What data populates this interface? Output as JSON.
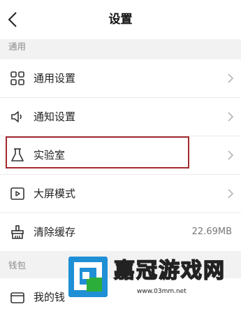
{
  "header": {
    "title": "设置"
  },
  "sections": [
    {
      "label": "通用"
    },
    {
      "label": "钱包"
    }
  ],
  "rows": [
    {
      "label": "通用设置",
      "icon": "grid-icon"
    },
    {
      "label": "通知设置",
      "icon": "speaker-icon"
    },
    {
      "label": "实验室",
      "icon": "flask-icon"
    },
    {
      "label": "大屏模式",
      "icon": "play-screen-icon"
    },
    {
      "label": "清除缓存",
      "icon": "broom-icon",
      "value": "22.69MB"
    },
    {
      "label": "我的钱",
      "icon": "wallet-icon"
    }
  ],
  "watermark": {
    "title": "嘉冠游戏网",
    "url": "www.03mm.net"
  },
  "colors": {
    "highlight": "#a32a2f",
    "watermark_blue": "#1f8fd6",
    "watermark_green": "#2cae3a"
  }
}
